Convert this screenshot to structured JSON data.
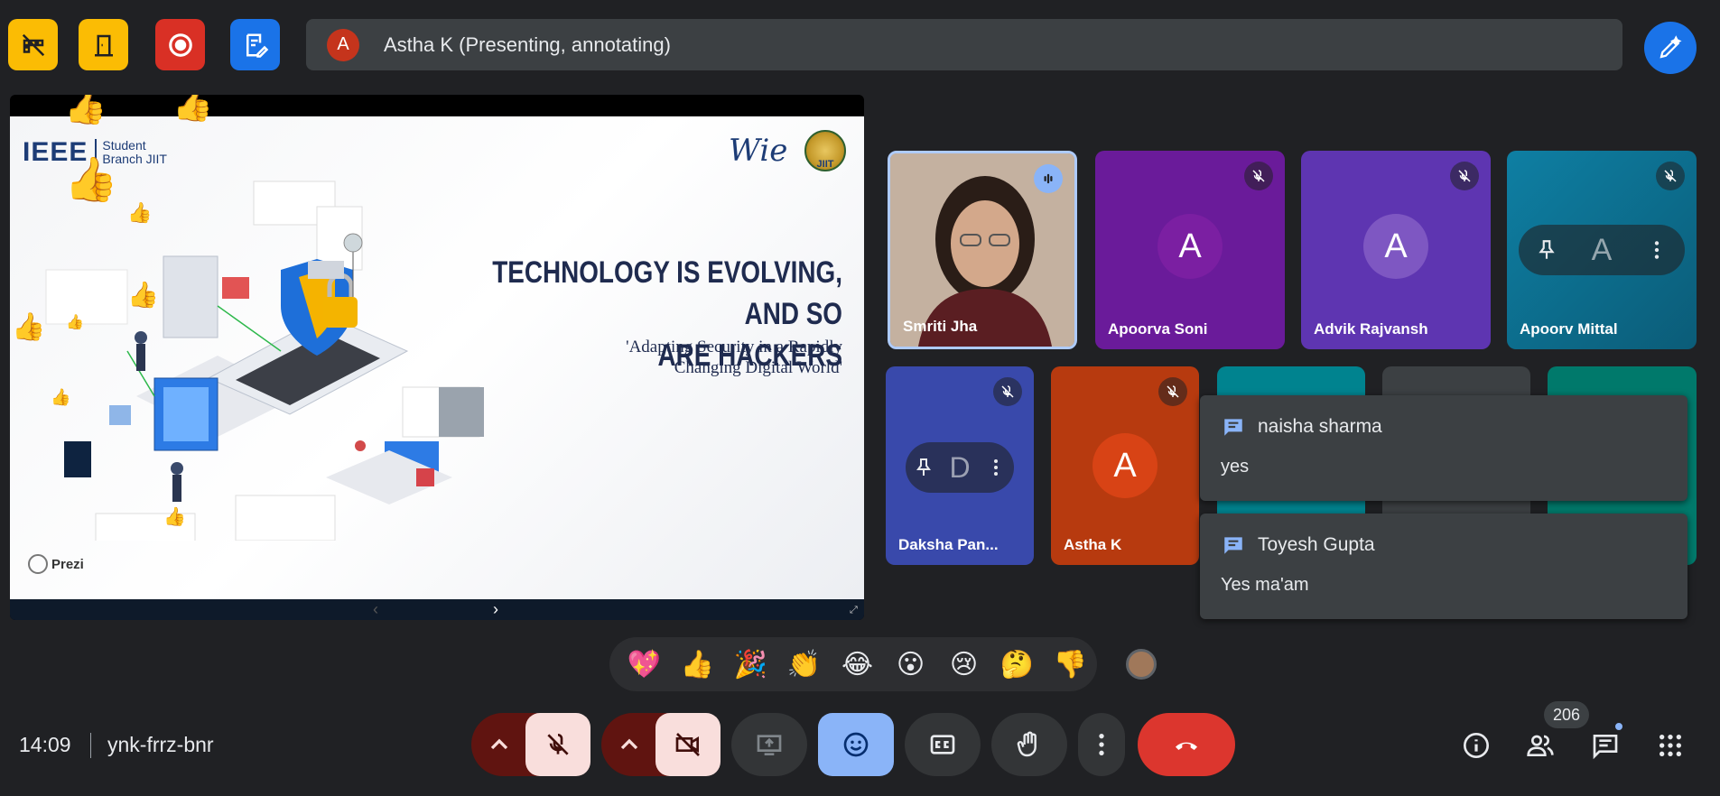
{
  "top_buttons": [
    {
      "name": "captions-off-button",
      "color": "#fbbc04",
      "icon": "hide-tiles-icon"
    },
    {
      "name": "breakout-rooms-button",
      "color": "#fbbc04",
      "icon": "door-icon"
    },
    {
      "name": "recording-button",
      "color": "#d93025",
      "icon": "record-icon"
    },
    {
      "name": "notes-button",
      "color": "#1a73e8",
      "icon": "notes-icon"
    }
  ],
  "presenter": {
    "avatar_letter": "A",
    "label": "Astha K (Presenting, annotating)"
  },
  "slide": {
    "org_ieee": "IEEE",
    "org_branch_line1": "Student",
    "org_branch_line2": "Branch JIIT",
    "wie_text": "Wie",
    "jiit_text": "JIIT",
    "title_line1": "TECHNOLOGY IS EVOLVING, AND SO",
    "title_line2": "ARE HACKERS",
    "subtitle_line1": "'Adapting Security in a Rapidly",
    "subtitle_line2": "Changing Digital World'",
    "prezi_label": "Prezi"
  },
  "participants": [
    {
      "name": "Smriti Jha",
      "type": "video",
      "status": "speaking"
    },
    {
      "name": "Apoorva Soni",
      "letter": "A",
      "bg": "#6a1b9a",
      "avatar_bg": "#7b1fa2",
      "muted": true
    },
    {
      "name": "Advik Rajvansh",
      "letter": "A",
      "bg": "#5e35b1",
      "avatar_bg": "#7e57c2",
      "muted": true
    },
    {
      "name": "Apoorv Mittal",
      "letter": "A",
      "bg": "#0b6e8f",
      "avatar_bg": "#2b7b96",
      "muted": true
    },
    {
      "name": "Daksha Pan...",
      "letter": "D",
      "bg": "#3949ab",
      "avatar_bg": "#5c6bc0",
      "muted": true
    },
    {
      "name": "Astha K",
      "letter": "A",
      "bg": "#b73a0f",
      "avatar_bg": "#d84315",
      "muted": true
    }
  ],
  "chat_popups": [
    {
      "sender": "naisha sharma",
      "message": "yes"
    },
    {
      "sender": "Toyesh Gupta",
      "message": "Yes ma'am"
    }
  ],
  "reactions": [
    "💖",
    "👍",
    "🎉",
    "👏",
    "😂",
    "😮",
    "😢",
    "🤔",
    "👎"
  ],
  "meeting": {
    "time": "14:09",
    "code": "ynk-frrz-bnr"
  },
  "people_count": "206"
}
